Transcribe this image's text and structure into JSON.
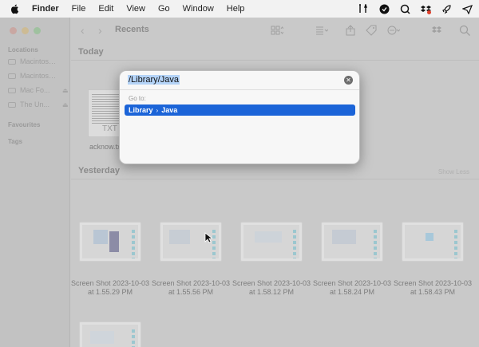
{
  "menubar": {
    "app_name": "Finder",
    "items": [
      "File",
      "Edit",
      "View",
      "Go",
      "Window",
      "Help"
    ],
    "status_icons": [
      "tools-icon",
      "shield-icon",
      "magnifier-icon",
      "dropbox-badge-icon",
      "rocket-icon",
      "paper-plane-icon"
    ]
  },
  "window": {
    "title": "Recents",
    "sidebar": {
      "locations_heading": "Locations",
      "locations": [
        {
          "label": "Macintosh...",
          "eject": false
        },
        {
          "label": "Macintosh...",
          "eject": false
        },
        {
          "label": "Mac Fo...",
          "eject": true
        },
        {
          "label": "The Un...",
          "eject": true
        }
      ],
      "favourites_heading": "Favourites",
      "tags_heading": "Tags"
    },
    "today_heading": "Today",
    "today_files": [
      {
        "name": "acknow.txt",
        "kind_badge": "TXT"
      }
    ],
    "yesterday_heading": "Yesterday",
    "show_less_label": "Show Less",
    "yesterday_files": [
      {
        "line1": "Screen Shot 2023-10-03",
        "line2": "at 1.55.29 PM"
      },
      {
        "line1": "Screen Shot 2023-10-03",
        "line2": "at 1.55.56 PM"
      },
      {
        "line1": "Screen Shot 2023-10-03",
        "line2": "at 1.58.12 PM"
      },
      {
        "line1": "Screen Shot 2023-10-03",
        "line2": "at 1.58.24 PM"
      },
      {
        "line1": "Screen Shot 2023-10-03",
        "line2": "at 1.58.43 PM"
      }
    ]
  },
  "goto_dialog": {
    "path_value": "/Library/Java",
    "goto_label": "Go to:",
    "suggestion": {
      "parent": "Library",
      "child": "Java"
    }
  },
  "colors": {
    "selection": "#1b64d8",
    "text_selection": "#b4d3f7",
    "close": "#ff5f57",
    "minimize": "#febc2e",
    "zoom": "#28c840"
  }
}
